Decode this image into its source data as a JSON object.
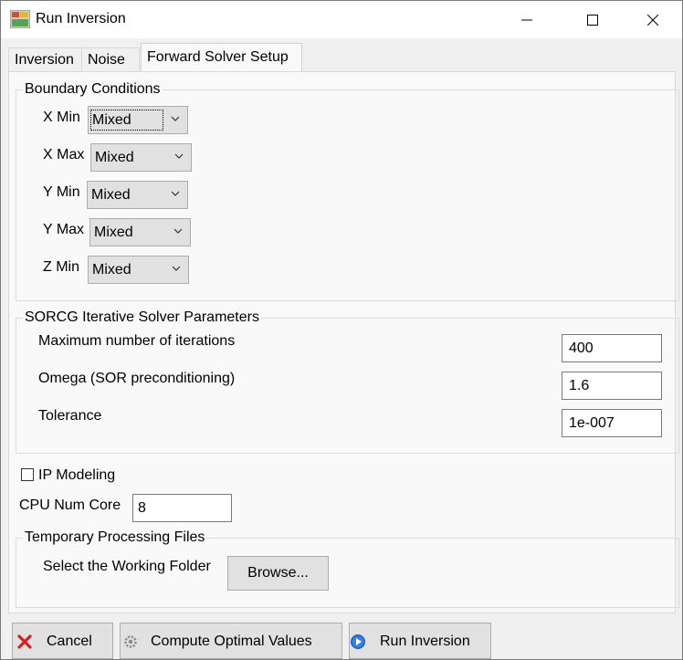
{
  "window": {
    "title": "Run Inversion",
    "minimize_glyph": "—",
    "maximize_glyph": "☐",
    "close_glyph": "✕"
  },
  "tabs": [
    {
      "label": "Inversion",
      "active": false
    },
    {
      "label": "Noise",
      "active": false
    },
    {
      "label": "Forward Solver Setup",
      "active": true
    }
  ],
  "boundary": {
    "title": "Boundary Conditions",
    "rows": [
      {
        "label": "X Min",
        "value": "Mixed"
      },
      {
        "label": "X Max",
        "value": "Mixed"
      },
      {
        "label": "Y Min",
        "value": "Mixed"
      },
      {
        "label": "Y Max",
        "value": "Mixed"
      },
      {
        "label": "Z Min",
        "value": "Mixed"
      }
    ]
  },
  "solver": {
    "title": "SORCG Iterative Solver Parameters",
    "rows": [
      {
        "label": "Maximum number of iterations",
        "value": "400"
      },
      {
        "label": "Omega (SOR preconditioning)",
        "value": "1.6"
      },
      {
        "label": "Tolerance",
        "value": "1e-007"
      }
    ]
  },
  "ip_modeling": {
    "label": "IP Modeling",
    "checked": false
  },
  "cpu": {
    "label": "CPU Num Core",
    "value": "8"
  },
  "temp": {
    "title": "Temporary Processing Files",
    "label": "Select the Working Folder",
    "browse": "Browse..."
  },
  "footer": {
    "cancel": "Cancel",
    "compute": "Compute Optimal Values",
    "run": "Run Inversion"
  },
  "colors": {
    "cancel_icon": "#d42020",
    "run_icon": "#1f5fbf",
    "gear_icon": "#8a8a8a"
  }
}
